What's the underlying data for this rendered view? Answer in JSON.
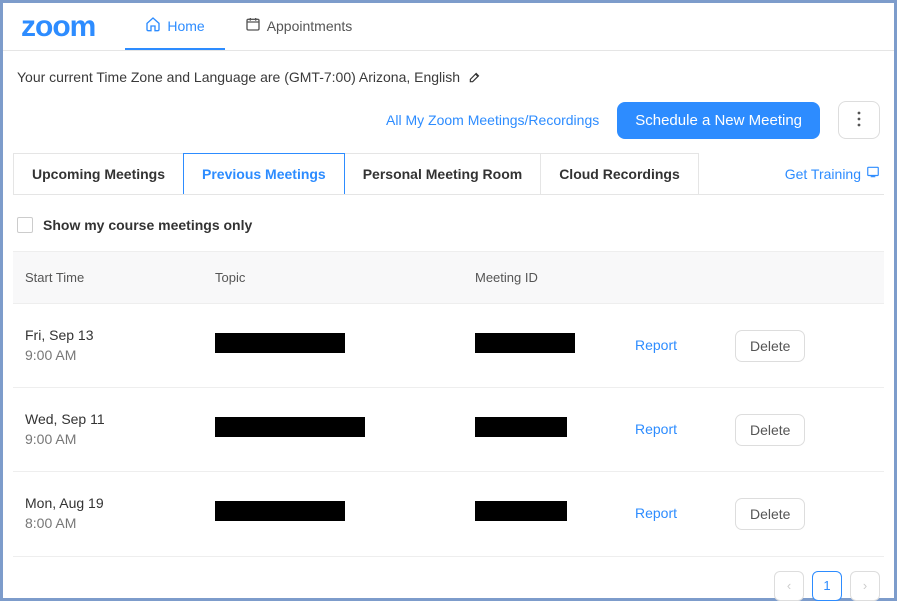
{
  "brand": "zoom",
  "nav": {
    "home": "Home",
    "appointments": "Appointments"
  },
  "info": {
    "text": "Your current Time Zone and Language are (GMT-7:00) Arizona, English"
  },
  "actions": {
    "all_meetings_link": "All My Zoom Meetings/Recordings",
    "schedule_button": "Schedule a New Meeting"
  },
  "subtabs": {
    "upcoming": "Upcoming Meetings",
    "previous": "Previous Meetings",
    "personal": "Personal Meeting Room",
    "cloud": "Cloud Recordings",
    "get_training": "Get Training"
  },
  "filter": {
    "course_only": "Show my course meetings only"
  },
  "table": {
    "headers": {
      "start_time": "Start Time",
      "topic": "Topic",
      "meeting_id": "Meeting ID"
    },
    "rows": [
      {
        "date": "Fri, Sep 13",
        "time": "9:00 AM",
        "report": "Report",
        "delete": "Delete"
      },
      {
        "date": "Wed, Sep 11",
        "time": "9:00 AM",
        "report": "Report",
        "delete": "Delete"
      },
      {
        "date": "Mon, Aug 19",
        "time": "8:00 AM",
        "report": "Report",
        "delete": "Delete"
      }
    ]
  },
  "pagination": {
    "page": "1"
  }
}
